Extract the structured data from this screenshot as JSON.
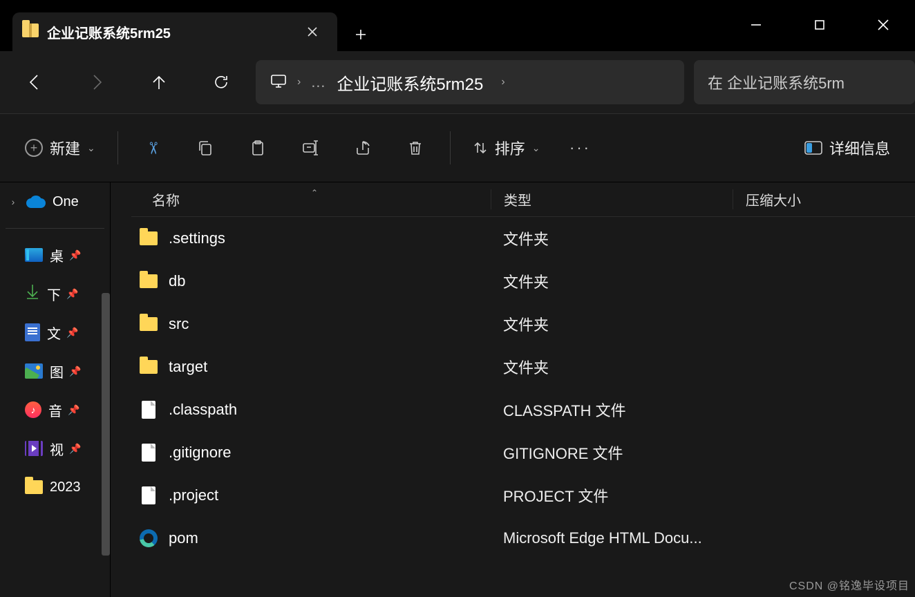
{
  "window": {
    "tab_title": "企业记账系统5rm25"
  },
  "breadcrumb": {
    "current": "企业记账系统5rm25"
  },
  "search": {
    "placeholder_prefix": "在 企业记账系统5rm"
  },
  "toolbar": {
    "new_label": "新建",
    "sort_label": "排序",
    "view_label": "详细信息"
  },
  "columns": {
    "name": "名称",
    "type": "类型",
    "size": "压缩大小"
  },
  "sidebar": {
    "onedrive": "One",
    "items": [
      {
        "icon": "desktop",
        "label": "桌"
      },
      {
        "icon": "download",
        "label": "下"
      },
      {
        "icon": "document",
        "label": "文"
      },
      {
        "icon": "image",
        "label": "图"
      },
      {
        "icon": "music",
        "label": "音"
      },
      {
        "icon": "video",
        "label": "视"
      },
      {
        "icon": "folder",
        "label": "2023"
      }
    ]
  },
  "files": [
    {
      "icon": "folder",
      "name": ".settings",
      "type": "文件夹",
      "size": ""
    },
    {
      "icon": "folder",
      "name": "db",
      "type": "文件夹",
      "size": ""
    },
    {
      "icon": "folder",
      "name": "src",
      "type": "文件夹",
      "size": ""
    },
    {
      "icon": "folder",
      "name": "target",
      "type": "文件夹",
      "size": ""
    },
    {
      "icon": "file",
      "name": ".classpath",
      "type": "CLASSPATH 文件",
      "size": ""
    },
    {
      "icon": "file",
      "name": ".gitignore",
      "type": "GITIGNORE 文件",
      "size": ""
    },
    {
      "icon": "file",
      "name": ".project",
      "type": "PROJECT 文件",
      "size": ""
    },
    {
      "icon": "edge",
      "name": "pom",
      "type": "Microsoft Edge HTML Docu...",
      "size": ""
    }
  ],
  "watermark": "CSDN @铭逸毕设项目"
}
